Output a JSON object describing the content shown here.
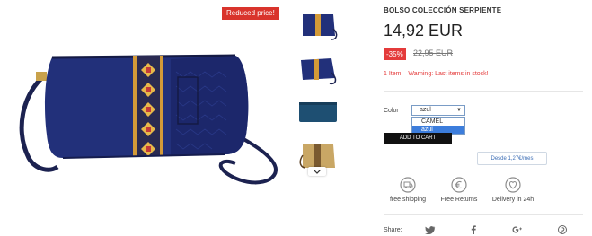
{
  "gallery": {
    "badge": "Reduced price!",
    "thumbnails": [
      {
        "icon": "bag-front-blue-thumbnail"
      },
      {
        "icon": "bag-angle-blue-thumbnail"
      },
      {
        "icon": "bag-back-blue-thumbnail"
      },
      {
        "icon": "bag-camel-thumbnail"
      }
    ],
    "scroll_icon": "chevron-down-icon"
  },
  "product": {
    "title": "BOLSO COLECCIÓN SERPIENTE",
    "price": "14,92 EUR",
    "discount": "-35%",
    "old_price": "22,95 EUR",
    "stock_quantity": "1 Item",
    "stock_warning": "Warning: Last items in stock!"
  },
  "color_selector": {
    "label": "Color",
    "selected": "azul",
    "options": [
      "CAMEL",
      "azul"
    ]
  },
  "cart": {
    "add_label": "ADD TO CART"
  },
  "financing": {
    "label": "Desde 1,27€/mes"
  },
  "benefits": [
    {
      "label": "free shipping",
      "icon": "free-shipping-icon"
    },
    {
      "label": "Free Returns",
      "icon": "euro-returns-icon"
    },
    {
      "label": "Delivery in 24h",
      "icon": "heart-delivery-icon"
    }
  ],
  "share": {
    "label": "Share:",
    "networks": [
      {
        "name": "twitter",
        "glyph": "🐦"
      },
      {
        "name": "facebook",
        "glyph": "f"
      },
      {
        "name": "googleplus",
        "glyph": "g+"
      },
      {
        "name": "pinterest",
        "glyph": "℗"
      }
    ]
  },
  "colors": {
    "accent_red": "#e43b3b",
    "bag_blue": "#22307a",
    "button_black": "#111111",
    "link_blue": "#3b6db5"
  }
}
